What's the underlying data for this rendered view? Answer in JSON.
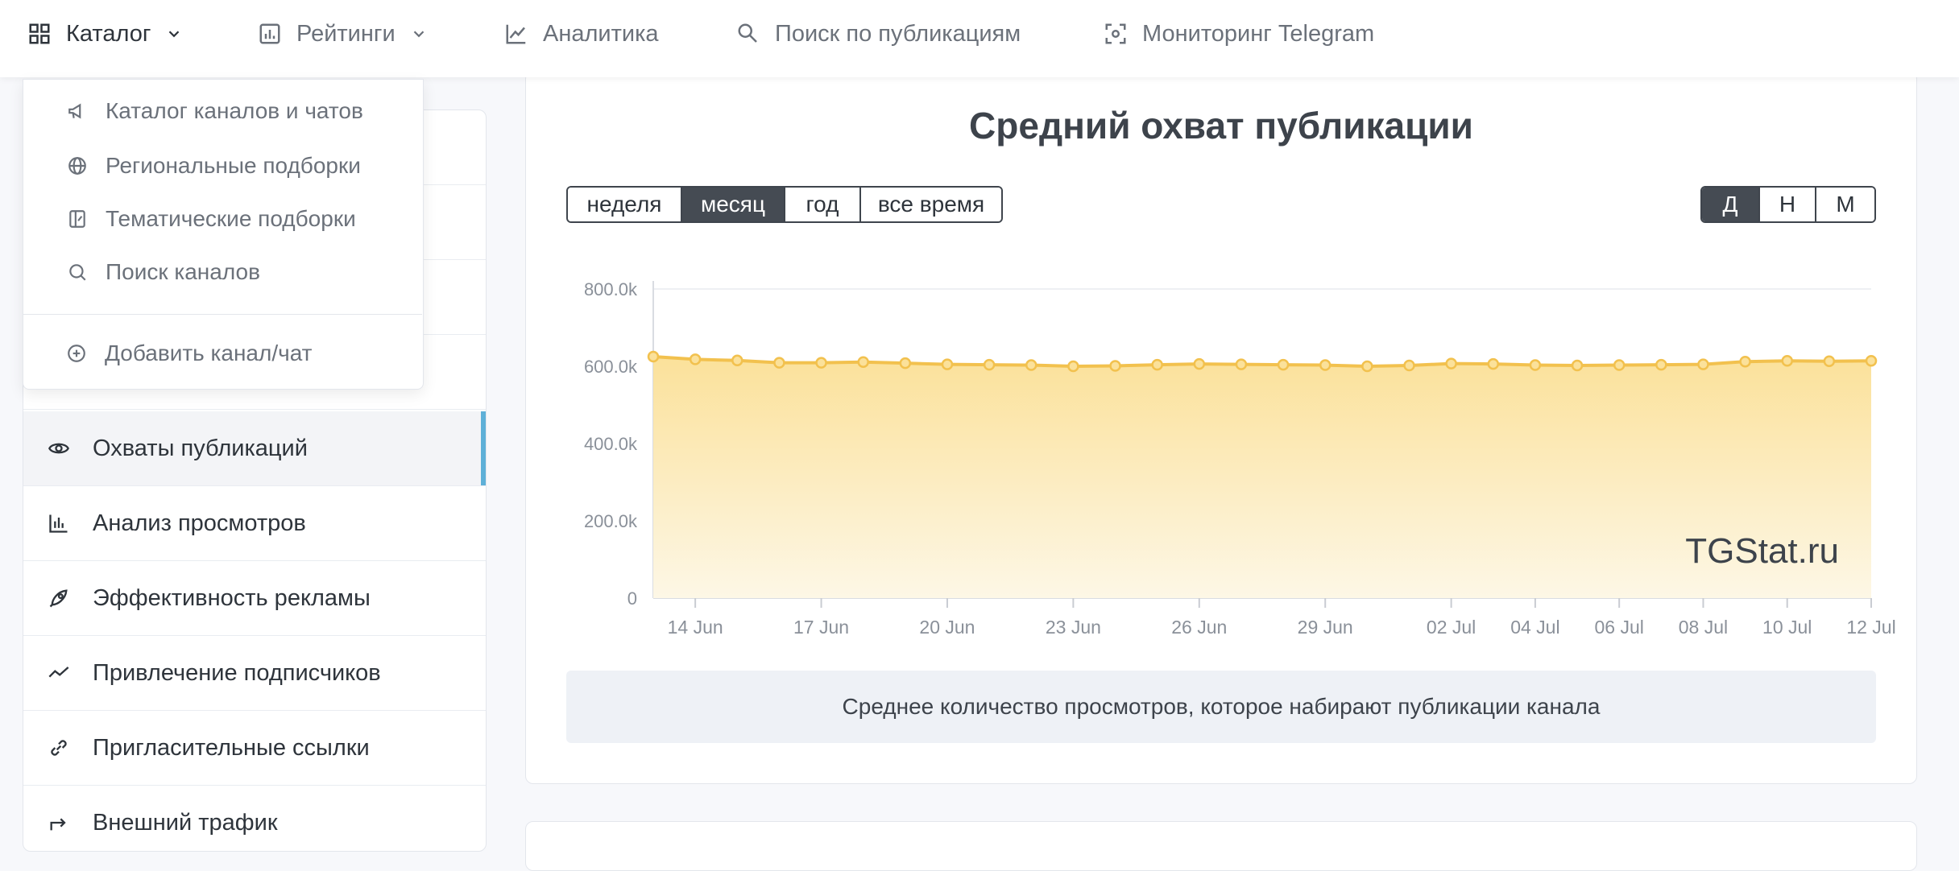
{
  "nav": {
    "items": [
      {
        "label": "Каталог",
        "icon": "grid-icon"
      },
      {
        "label": "Рейтинги",
        "icon": "bar-chart-icon"
      },
      {
        "label": "Аналитика",
        "icon": "line-chart-icon"
      },
      {
        "label": "Поиск по публикациям",
        "icon": "search-icon"
      },
      {
        "label": "Мониторинг Telegram",
        "icon": "scan-icon"
      }
    ]
  },
  "dropdown": {
    "items": [
      {
        "label": "Каталог каналов и чатов",
        "icon": "megaphone-icon"
      },
      {
        "label": "Региональные подборки",
        "icon": "globe-icon"
      },
      {
        "label": "Тематические подборки",
        "icon": "collection-icon"
      },
      {
        "label": "Поиск каналов",
        "icon": "search-icon"
      }
    ],
    "add": {
      "label": "Добавить канал/чат",
      "icon": "plus-circle-icon"
    }
  },
  "sidebar": {
    "items": [
      {
        "label": "Охваты публикаций",
        "icon": "eye-icon",
        "active": true
      },
      {
        "label": "Анализ просмотров",
        "icon": "bar-chart-icon"
      },
      {
        "label": "Эффективность рекламы",
        "icon": "rocket-icon"
      },
      {
        "label": "Привлечение подписчиков",
        "icon": "trend-icon"
      },
      {
        "label": "Пригласительные ссылки",
        "icon": "link-icon"
      },
      {
        "label": "Внешний трафик",
        "icon": "share-icon"
      }
    ]
  },
  "card": {
    "title": "Средний охват публикации",
    "periods": [
      "неделя",
      "месяц",
      "год",
      "все время"
    ],
    "active_period": "месяц",
    "granularity": [
      "Д",
      "Н",
      "М"
    ],
    "active_granularity": "Д",
    "caption": "Среднее количество просмотров, которое набирают публикации канала",
    "watermark": "TGStat.ru"
  },
  "colors": {
    "line": "#f2c14e",
    "fill_top": "#fbe3a0",
    "fill_bottom": "#fdf6e3",
    "accent": "#5eb0d8",
    "dark_button": "#454b53"
  },
  "chart_data": {
    "type": "area",
    "x": [
      "13 Jun",
      "14 Jun",
      "15 Jun",
      "16 Jun",
      "17 Jun",
      "18 Jun",
      "19 Jun",
      "20 Jun",
      "21 Jun",
      "22 Jun",
      "23 Jun",
      "24 Jun",
      "25 Jun",
      "26 Jun",
      "27 Jun",
      "28 Jun",
      "29 Jun",
      "30 Jun",
      "01 Jul",
      "02 Jul",
      "03 Jul",
      "04 Jul",
      "05 Jul",
      "06 Jul",
      "07 Jul",
      "08 Jul",
      "09 Jul",
      "10 Jul",
      "11 Jul",
      "12 Jul"
    ],
    "tick_labels": [
      "14 Jun",
      "17 Jun",
      "20 Jun",
      "23 Jun",
      "26 Jun",
      "29 Jun",
      "02 Jul",
      "04 Jul",
      "06 Jul",
      "08 Jul",
      "10 Jul",
      "12 Jul"
    ],
    "tick_indices": [
      1,
      4,
      7,
      10,
      13,
      16,
      19,
      21,
      23,
      25,
      27,
      29
    ],
    "values": [
      625000,
      618000,
      615000,
      609000,
      609000,
      611000,
      608000,
      605000,
      604000,
      603000,
      600000,
      601000,
      604000,
      606000,
      605000,
      604000,
      603000,
      600000,
      602000,
      607000,
      606000,
      603000,
      602000,
      603000,
      604000,
      605000,
      612000,
      614000,
      613000,
      614000
    ],
    "ylim": [
      0,
      800000
    ],
    "y_ticks": [
      0,
      200000,
      400000,
      600000,
      800000
    ],
    "y_tick_labels": [
      "0",
      "200.0k",
      "400.0k",
      "600.0k",
      "800.0k"
    ],
    "grid": "horizontal",
    "watermark": "TGStat.ru"
  }
}
